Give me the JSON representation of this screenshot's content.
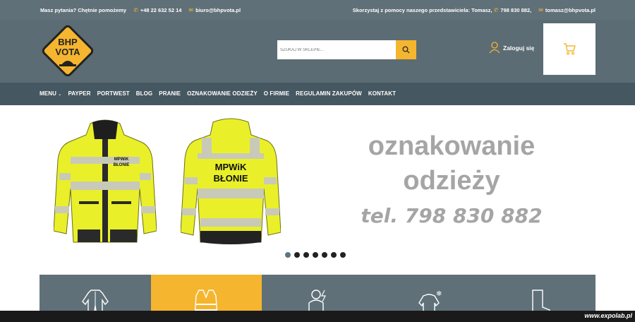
{
  "topbar": {
    "question": "Masz pytania? Chętnie pomożemy",
    "phone": "+48 22 632 52 14",
    "email": "biuro@bhpvota.pl",
    "representative": "Skorzystaj z pomocy naszego przedstawiciela: Tomasz,",
    "rep_phone": "798 830 882,",
    "rep_email": "tomasz@bhpvota.pl"
  },
  "logo": {
    "line1": "BHP",
    "line2": "VOTA"
  },
  "search": {
    "placeholder": "SZUKAJ W SKLEPIE..."
  },
  "login": {
    "label": "Zaloguj się"
  },
  "nav": {
    "items": [
      "MENU",
      "PAYPER",
      "PORTWEST",
      "BLOG",
      "PRANIE",
      "OZNAKOWANIE ODZIEŻY",
      "O FIRMIE",
      "REGULAMIN ZAKUPÓW",
      "KONTAKT"
    ]
  },
  "hero": {
    "jacket_text_1": "MPWiK\nBŁONIE",
    "jacket_text_2_l1": "MPWiK",
    "jacket_text_2_l2": "BŁONIE",
    "title_l1": "oznakowanie",
    "title_l2": "odzieży",
    "phone": "tel. 798 830 882",
    "dots_count": 7,
    "active_dot": 0
  },
  "categories": [
    {
      "icon": "coverall-icon",
      "color": "#5f7078"
    },
    {
      "icon": "vest-icon",
      "color": "#f5b52e"
    },
    {
      "icon": "electric-suit-icon",
      "color": "#5f7078"
    },
    {
      "icon": "winter-jacket-icon",
      "color": "#5f7078"
    },
    {
      "icon": "boot-icon",
      "color": "#5f7078"
    }
  ],
  "watermark": "www.expolab.pl",
  "colors": {
    "accent": "#f5b52e",
    "header": "#5c6c74",
    "nav": "#455760",
    "text_gray": "#a5a5a5"
  }
}
